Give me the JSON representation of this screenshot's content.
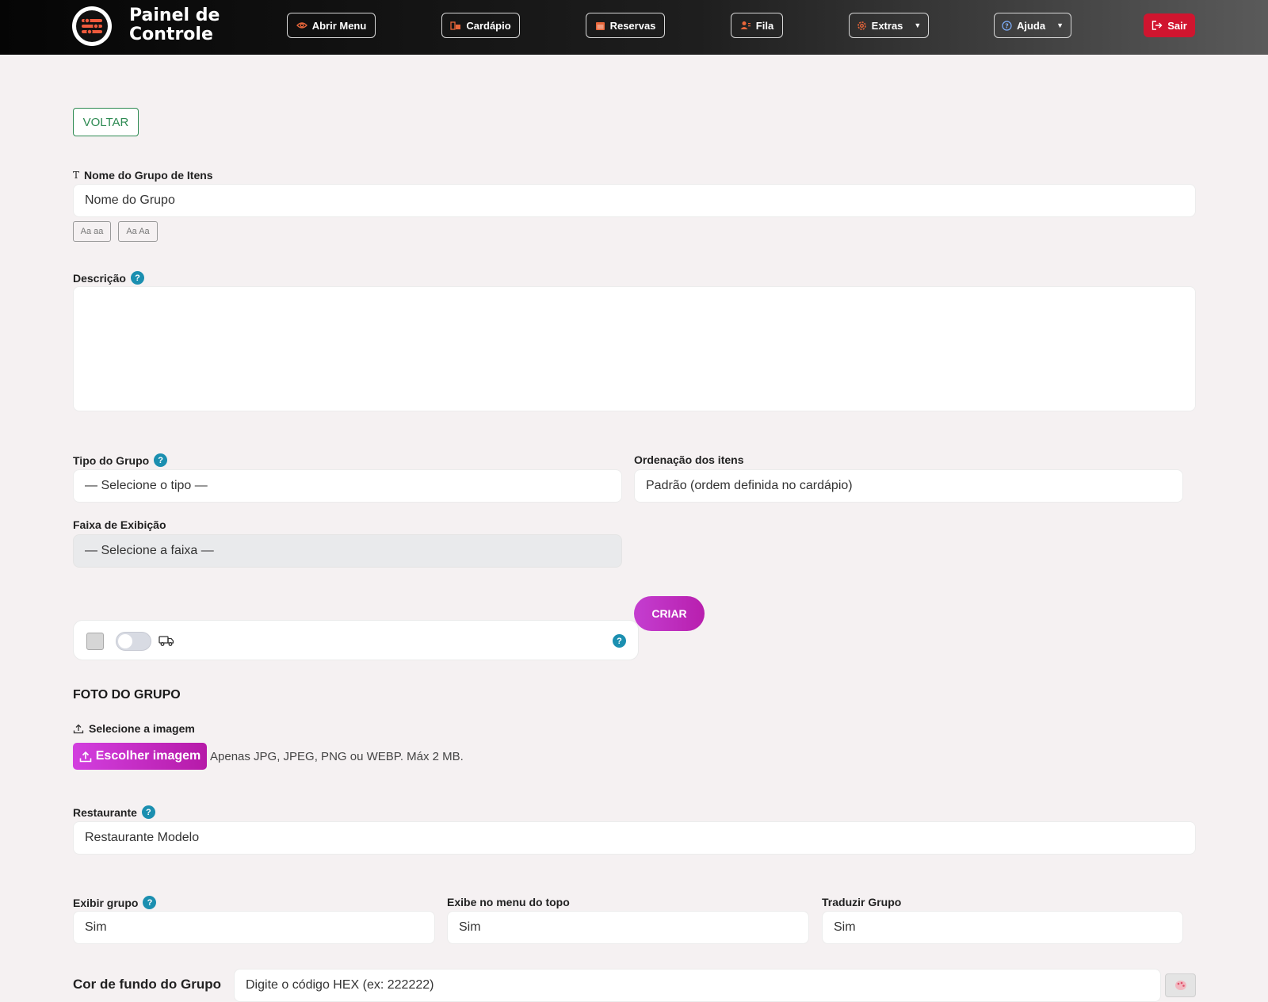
{
  "header": {
    "brand_line1": "Painel de",
    "brand_line2": "Controle",
    "nav": {
      "abrir_menu": "Abrir Menu",
      "cardapio": "Cardápio",
      "reservas": "Reservas",
      "fila": "Fila",
      "extras": "Extras",
      "ajuda": "Ajuda",
      "sair": "Sair"
    }
  },
  "form": {
    "voltar": "VOLTAR",
    "nome": {
      "label": "Nome do Grupo de Itens",
      "value": "Nome do Grupo"
    },
    "case_buttons": [
      "Aa aa",
      "Aa Aa"
    ],
    "descricao": {
      "label": "Descrição"
    },
    "tipo": {
      "label": "Tipo do Grupo",
      "value": "— Selecione o tipo —"
    },
    "ordenacao": {
      "label": "Ordenação dos itens",
      "value": "Padrão (ordem definida no cardápio)"
    },
    "faixa": {
      "label": "Faixa de Exibição",
      "value": "— Selecione a faixa —"
    },
    "criar": "CRIAR",
    "help_symbol": "?",
    "foto": {
      "title": "FOTO DO GRUPO",
      "select_label": "Selecione a imagem",
      "button": "Escolher imagem",
      "hint": "Apenas JPG, JPEG, PNG ou WEBP. Máx 2 MB."
    },
    "restaurante": {
      "label": "Restaurante",
      "value": "Restaurante Modelo"
    },
    "exibir_grupo": {
      "label": "Exibir grupo",
      "value": "Sim"
    },
    "exibe_menu_topo": {
      "label": "Exibe no menu do topo",
      "value": "Sim"
    },
    "traduzir": {
      "label": "Traduzir Grupo",
      "value": "Sim"
    },
    "cor_fundo": {
      "label": "Cor de fundo do Grupo",
      "placeholder": "Digite o código HEX (ex: 222222)"
    }
  },
  "colors": {
    "accent_pink": "#c43ed0",
    "danger": "#d0152f",
    "success": "#2d8a52",
    "info": "#1b8fb0",
    "icon_orange": "#e8663a"
  }
}
